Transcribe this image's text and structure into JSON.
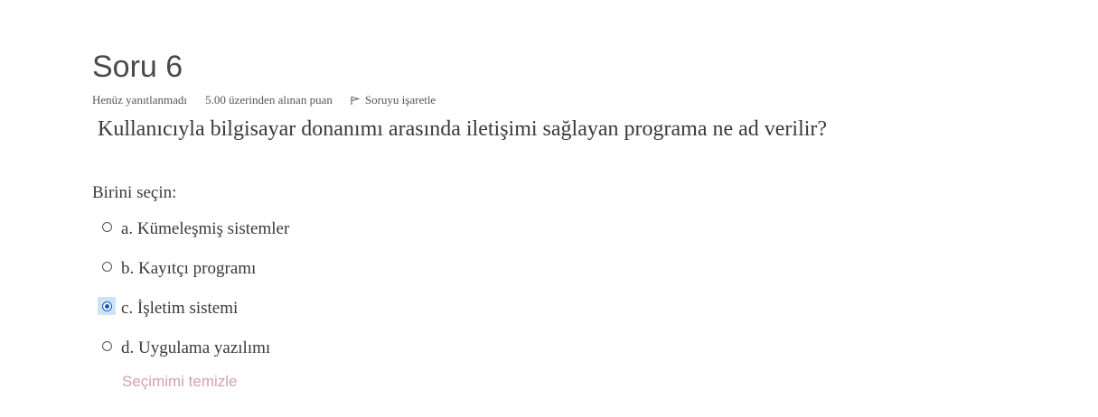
{
  "question": {
    "title": "Soru 6",
    "state": "Henüz yanıtlanmadı",
    "grade": "5.00 üzerinden alınan puan",
    "flag_label": "Soruyu işaretle",
    "text": "Kullanıcıyla bilgisayar donanımı arasında iletişimi sağlayan programa ne ad verilir?",
    "prompt": "Birini seçin:",
    "answers": [
      {
        "label": "a. Kümeleşmiş sistemler",
        "selected": false
      },
      {
        "label": "b. Kayıtçı programı",
        "selected": false
      },
      {
        "label": "c. İşletim sistemi",
        "selected": true
      },
      {
        "label": "d. Uygulama yazılımı",
        "selected": false
      }
    ],
    "clear_label": "Seçimimi temizle"
  },
  "colors": {
    "selected_highlight": "#cfe3f7",
    "radio_checked": "#0b5cbd",
    "clear_link": "#d4a0b0"
  },
  "icons": {
    "flag": "flag-icon"
  }
}
